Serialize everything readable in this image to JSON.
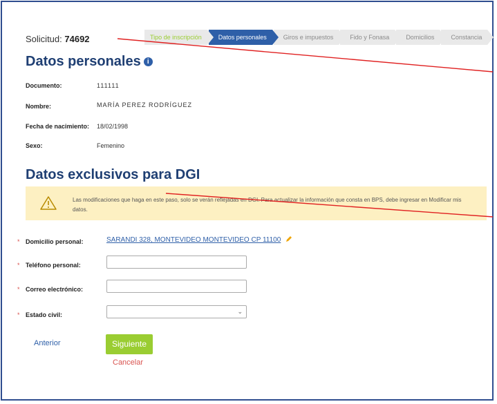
{
  "header": {
    "solicitud_label": "Solicitud:",
    "solicitud_number": "74692",
    "steps": [
      {
        "label": "Tipo de inscripción",
        "active": false
      },
      {
        "label": "Datos personales",
        "active": true
      },
      {
        "label": "Giros e impuestos",
        "active": false
      },
      {
        "label": "Fido y Fonasa",
        "active": false
      },
      {
        "label": "Domicilios",
        "active": false
      },
      {
        "label": "Constancia",
        "active": false
      }
    ]
  },
  "personal": {
    "title": "Datos personales",
    "info_icon": "info-icon",
    "documento_label": "Documento:",
    "documento_value": "111111",
    "nombre_label": "Nombre:",
    "nombre_value": "MARÍA PEREZ RODRÍGUEZ",
    "nacimiento_label": "Fecha de nacimiento:",
    "nacimiento_value": "18/02/1998",
    "sexo_label": "Sexo:",
    "sexo_value": "Femenino"
  },
  "dgi": {
    "title": "Datos exclusivos para DGI",
    "warning_icon": "warning-triangle-icon",
    "warning_text": "Las modificaciones que haga en este paso, solo se verán reflejadas en DGI. Para actualizar la información que consta en BPS, debe ingresar en Modificar mis datos.",
    "domicilio_label": "Domicilio personal:",
    "domicilio_value": "SARANDI 328, MONTEVIDEO MONTEVIDEO CP 11100",
    "edit_icon": "pencil-icon",
    "telefono_label": "Teléfono personal:",
    "telefono_value": "",
    "correo_label": "Correo electrónico:",
    "correo_value": "",
    "estado_label": "Estado civil:",
    "estado_value": "",
    "required_mark": "*"
  },
  "actions": {
    "anterior": "Anterior",
    "siguiente": "Siguiente",
    "cancelar": "Cancelar"
  },
  "colors": {
    "accent": "#2e5fa8",
    "title": "#1f3f73",
    "next_button": "#9acd32",
    "warning_bg": "#fdf0c2",
    "cancel": "#d9534f",
    "annotation_line": "#e02020"
  }
}
